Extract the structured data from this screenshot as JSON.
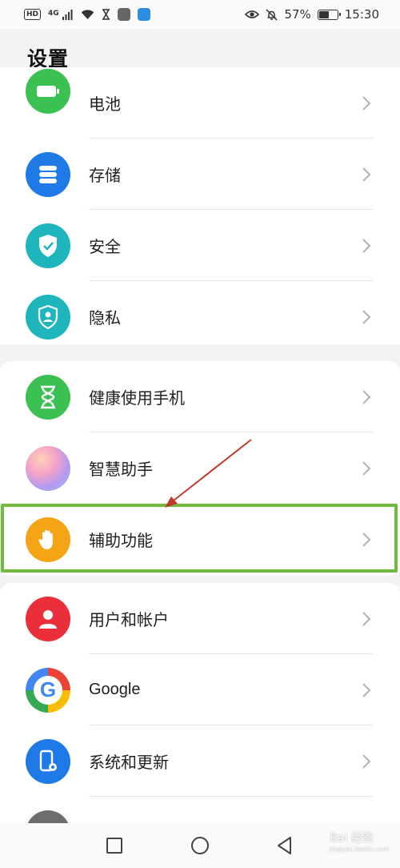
{
  "status_bar": {
    "hd": "HD",
    "network": "4G",
    "battery_percent": "57%",
    "battery_level": 0.57,
    "time": "15:30",
    "icons": [
      "signal-icon",
      "wifi-icon",
      "hourglass-icon",
      "app-icon",
      "app-icon",
      "eye-icon",
      "bell-muted-icon",
      "battery-icon"
    ]
  },
  "page": {
    "title": "设置"
  },
  "groups": [
    {
      "items": [
        {
          "label": "电池",
          "icon": "battery-icon",
          "color": "#3bc152"
        },
        {
          "label": "存储",
          "icon": "storage-icon",
          "color": "#1f7ae8"
        },
        {
          "label": "安全",
          "icon": "shield-icon",
          "color": "#1fb5bd"
        },
        {
          "label": "隐私",
          "icon": "privacy-icon",
          "color": "#1fb5bd"
        }
      ]
    },
    {
      "items": [
        {
          "label": "健康使用手机",
          "icon": "hourglass-icon",
          "color": "#3bc152"
        },
        {
          "label": "智慧助手",
          "icon": "assistant-icon",
          "color": "#c9a8f0"
        },
        {
          "label": "辅助功能",
          "icon": "hand-icon",
          "color": "#f5a416"
        }
      ]
    },
    {
      "items": [
        {
          "label": "用户和帐户",
          "icon": "user-icon",
          "color": "#ea2f3a"
        },
        {
          "label": "Google",
          "icon": "google-icon",
          "color": "#ffffff"
        },
        {
          "label": "系统和更新",
          "icon": "system-update-icon",
          "color": "#1f7ae8"
        }
      ]
    }
  ],
  "annotation": {
    "highlight_color": "#6fbb3c",
    "arrow_color": "#c0392b"
  },
  "nav": {
    "icons": [
      "recent-apps-icon",
      "home-icon",
      "back-icon"
    ]
  },
  "watermark": {
    "text": "Bai 经验",
    "sub": "jingyan.baidu.com"
  }
}
